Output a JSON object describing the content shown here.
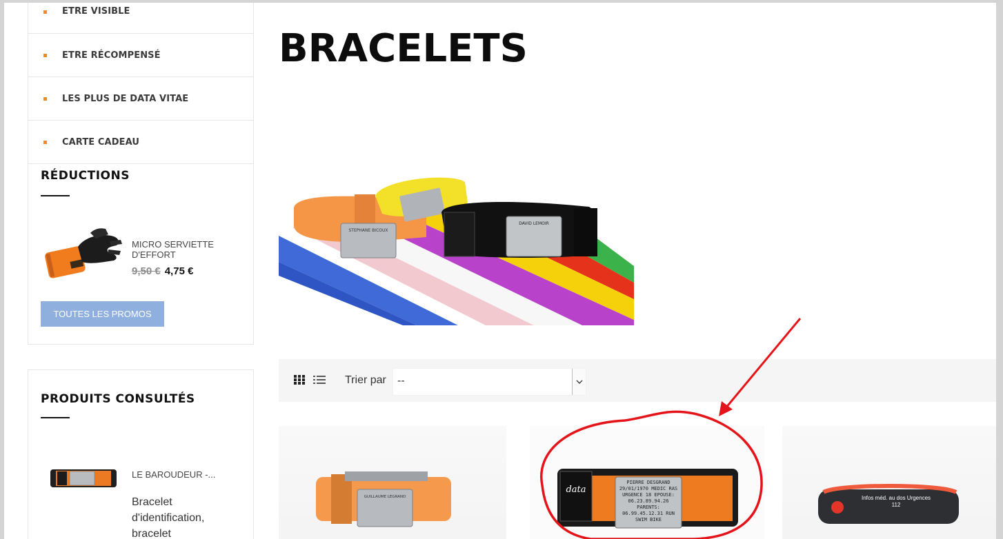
{
  "sidebar": {
    "menu": [
      {
        "label": "ETRE VISIBLE"
      },
      {
        "label": "ETRE RÉCOMPENSÉ"
      },
      {
        "label": "LES PLUS DE DATA VITAE"
      },
      {
        "label": "CARTE CADEAU"
      }
    ],
    "reductions": {
      "title": "RÉDUCTIONS",
      "product_name": "MICRO SERVIETTE D'EFFORT",
      "old_price": "9,50 €",
      "new_price": "4,75 €",
      "all_promos_label": "TOUTES LES PROMOS"
    },
    "viewed": {
      "title": "PRODUITS CONSULTÉS",
      "product_name": "LE BAROUDEUR -...",
      "product_desc": "Bracelet d'identification, bracelet"
    }
  },
  "main": {
    "title": "BRACELETS",
    "sort": {
      "label": "Trier par",
      "selected": "--"
    },
    "banner_engravings": {
      "orange": "STEPHANE BICOUX",
      "yellow": "",
      "black": "DAVID LEMOIR"
    },
    "products": [
      {
        "engraving": "GUILLAUME LEGRAND"
      },
      {
        "engraving": "PIERRE DESGRAND 29/01/1970 MEDIC RAS URGENCE 18 EPOUSE: 06.23.89.94.26 PARENTS: 06.99.45.12.31 RUN SWIM BIKE"
      },
      {
        "engraving": "Infos méd. au dos Urgences 112"
      }
    ]
  },
  "colors": {
    "accent_orange": "#f08a24",
    "promo_button": "#8fb0de",
    "annotation_red": "#e4151a"
  },
  "icons": [
    "grid-view-icon",
    "list-view-icon",
    "chevron-down-icon",
    "arrow-annotation",
    "circle-annotation"
  ]
}
